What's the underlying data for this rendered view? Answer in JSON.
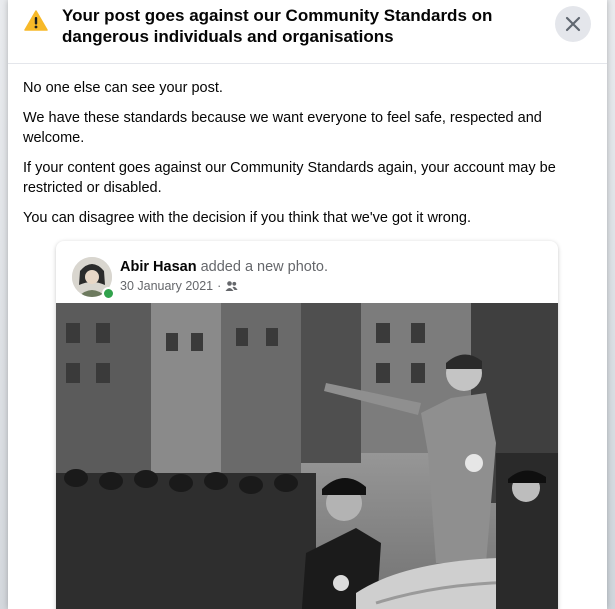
{
  "dialog": {
    "title": "Your post goes against our Community Standards on dangerous individuals and organisations",
    "paragraphs": [
      "No one else can see your post.",
      "We have these standards because we want everyone to feel safe, respected and welcome.",
      "If your content goes against our Community Standards again, your account may be restricted or disabled.",
      "You can disagree with the decision if you think that we've got it wrong."
    ],
    "warning_icon": "warning-triangle-icon",
    "close_icon": "close-icon"
  },
  "post": {
    "author": "Abir Hasan",
    "action": "added a new photo.",
    "date": "30 January 2021",
    "separator": "·",
    "audience_icon": "friends-icon",
    "online": true
  },
  "colors": {
    "warning": "#f7b928",
    "text_primary": "#050505",
    "text_secondary": "#65676b",
    "close_bg": "#e4e6eb",
    "online": "#31a24c"
  }
}
